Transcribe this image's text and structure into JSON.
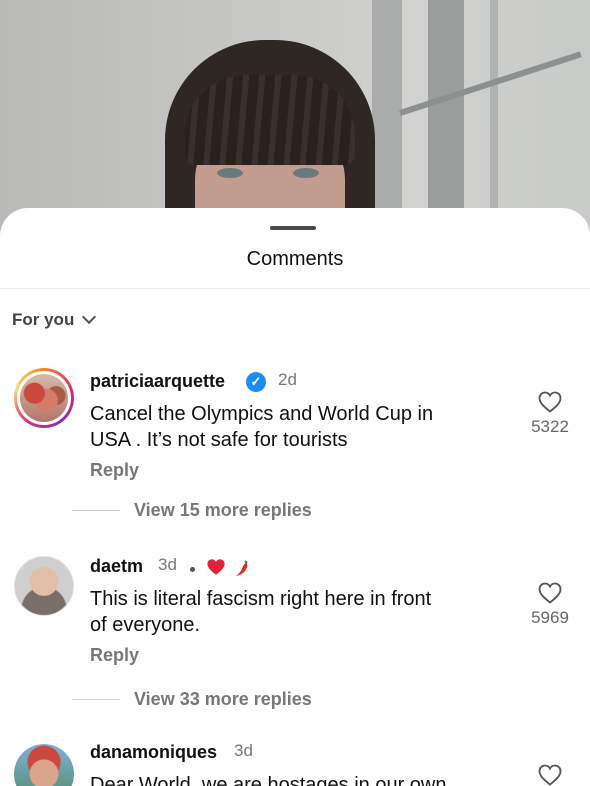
{
  "sheet": {
    "title": "Comments",
    "filter_label": "For you"
  },
  "comments": [
    {
      "username": "patriciaarquette",
      "verified": true,
      "time": "2d",
      "text_lines": [
        "Cancel the Olympics and World Cup in",
        "USA . It’s not safe for tourists"
      ],
      "reply_label": "Reply",
      "view_more": "View 15 more replies",
      "likes": "5322"
    },
    {
      "username": "daetm",
      "time": "3d",
      "badge_icons": [
        "heart-icon",
        "chili-pepper-icon"
      ],
      "text_lines": [
        "This is literal fascism right here in front",
        "of everyone."
      ],
      "reply_label": "Reply",
      "view_more": "View 33 more replies",
      "likes": "5969"
    },
    {
      "username": "danamoniques",
      "time": "3d",
      "text_lines": [
        "Dear World, we are hostages in our own"
      ]
    }
  ],
  "colors": {
    "verified_blue": "#1d8cf0",
    "heart_red": "#e0223a",
    "secondary_text": "#777777"
  }
}
